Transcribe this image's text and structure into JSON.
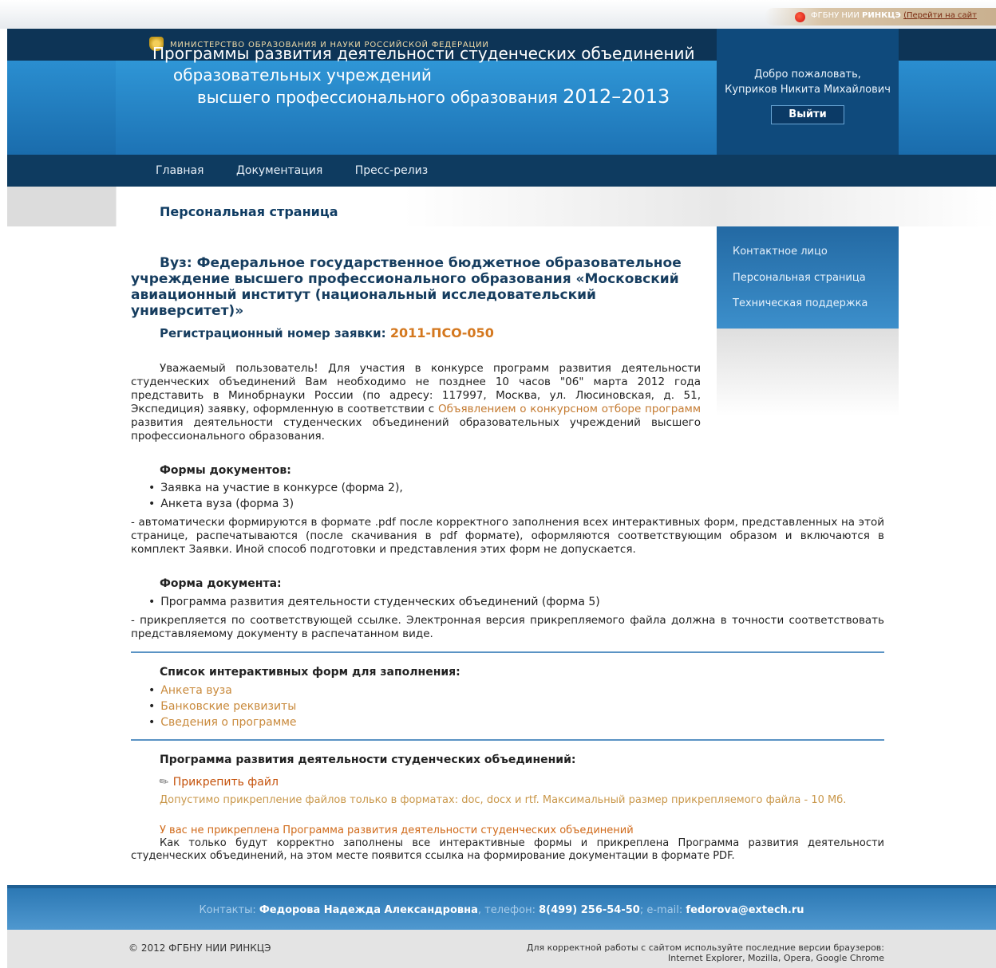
{
  "top_link": {
    "org": "ФГБНУ НИИ",
    "org_bold": "РИНКЦЭ",
    "link": "(Перейти на сайт"
  },
  "header": {
    "ministry": "МИНИСТЕРСТВО ОБРАЗОВАНИЯ И НАУКИ РОССИЙСКОЙ ФЕДЕРАЦИИ",
    "title_line1": "Программы развития деятельности студенческих объединений",
    "title_line2": "образовательных учреждений",
    "title_line3": "высшего профессионального образования",
    "title_years": "2012–2013",
    "welcome": "Добро пожаловать,",
    "user_name": "Куприков Никита Михайлович",
    "logout_label": "Выйти"
  },
  "nav": [
    "Главная",
    "Документация",
    "Пресс-релиз"
  ],
  "page_title": "Персональная страница",
  "sidebar": [
    "Контактное лицо",
    "Персональная страница",
    "Техническая поддержка"
  ],
  "main": {
    "university": "Вуз: Федеральное государственное бюджетное образовательное учреждение высшего профессионального образования «Московский авиационный институт (национальный исследовательский университет)»",
    "reg_label": "Регистрационный номер заявки:",
    "reg_number": "2011-ПСО-050",
    "intro_before": "Уважаемый пользователь! Для участия в конкурсе программ развития деятельности студенческих объединений Вам необходимо не позднее 10 часов \"06\" марта 2012 года представить в Минобрнауки России (по адресу: 117997, Москва, ул. Люсиновская, д. 51, Экспедиция) заявку, оформленную в соответствии с",
    "intro_link": "Объявлением о конкурсном отборе программ",
    "intro_after": "развития деятельности студенческих объединений образовательных учреждений высшего профессионального образования.",
    "forms_heading": "Формы документов:",
    "forms": [
      "Заявка на участие в конкурсе (форма 2),",
      "Анкета вуза (форма 3)"
    ],
    "forms_note": "- автоматически формируются в формате .pdf после корректного заполнения всех интерактивных форм, представленных на этой странице, распечатываются (после скачивания в pdf формате), оформляются соответствующим образом и включаются в комплект Заявки. Иной способ подготовки и представления этих форм не допускается.",
    "form_heading": "Форма документа:",
    "form_items": [
      "Программа развития деятельности студенческих объединений (форма 5)"
    ],
    "form_note": "- прикрепляется по соответствующей ссылке. Электронная версия прикрепляемого файла должна в точности соответствовать представляемому документу в распечатанном виде.",
    "interactive_heading": "Список интерактивных форм для заполнения:",
    "interactive_links": [
      "Анкета вуза",
      "Банковские реквизиты",
      "Сведения о программе"
    ],
    "program_heading": "Программа развития деятельности студенческих объединений:",
    "attach_label": "Прикрепить файл",
    "attach_note": "Допустимо прикрепление файлов только в форматах: doc, docx и rtf. Максимальный размер прикрепляемого файла - 10 Мб.",
    "warning": "У вас не прикреплена Программа развития деятельности студенческих объединений",
    "final_note": "Как только будут корректно заполнены все интерактивные формы и прикреплена Программа развития деятельности студенческих объединений, на этом месте появится ссылка на формирование документации в формате PDF."
  },
  "footer": {
    "contacts_label": "Контакты:",
    "contact_name": "Федорова Надежда Александровна",
    "phone_label": ", телефон:",
    "phone": "8(499) 256-54-50",
    "email_label": "; e-mail:",
    "email": "fedorova@extech.ru",
    "copyright": "© 2012 ФГБНУ НИИ РИНКЦЭ",
    "browsers_line1": "Для корректной работы с сайтом используйте последние версии браузеров:",
    "browsers_line2": "Internet Explorer, Mozilla, Opera, Google Chrome"
  }
}
